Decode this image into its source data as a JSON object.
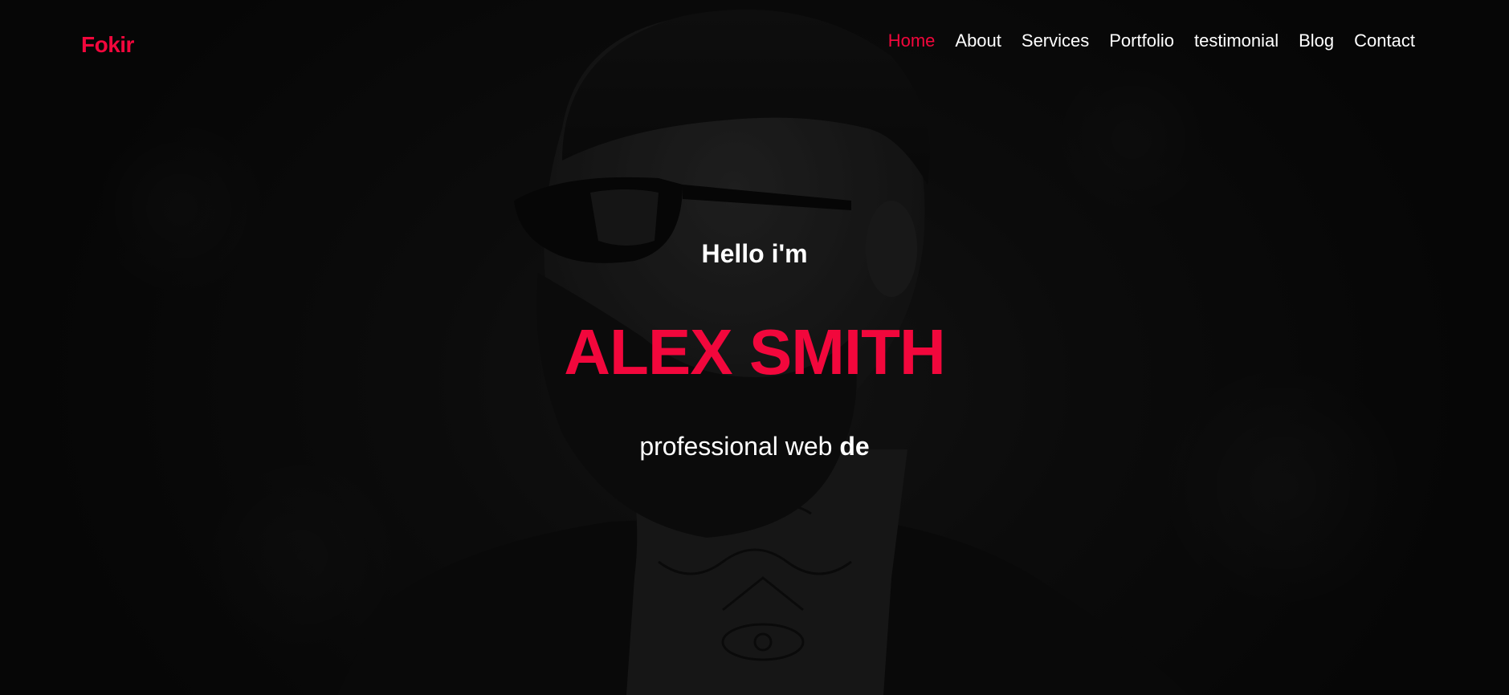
{
  "brand": {
    "logo_text": "Fokir",
    "accent_color": "#f2073c"
  },
  "nav": {
    "items": [
      {
        "label": "Home",
        "active": true
      },
      {
        "label": "About",
        "active": false
      },
      {
        "label": "Services",
        "active": false
      },
      {
        "label": "Portfolio",
        "active": false
      },
      {
        "label": "testimonial",
        "active": false
      },
      {
        "label": "Blog",
        "active": false
      },
      {
        "label": "Contact",
        "active": false
      }
    ]
  },
  "hero": {
    "greeting": "Hello i'm",
    "name": "ALEX SMITH",
    "tagline_static": "professional web ",
    "tagline_typed": "de",
    "background": "dark-portrait-photo"
  }
}
